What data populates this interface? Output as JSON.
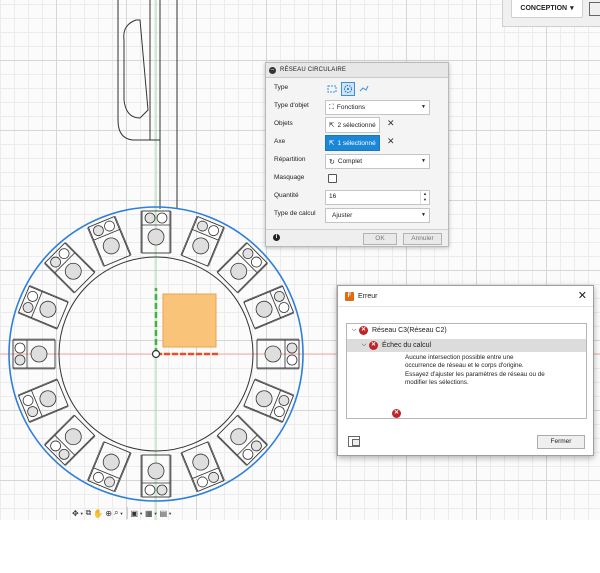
{
  "toolbar": {
    "workspace_label": "CONCEPTION",
    "workspace_caret": "▾"
  },
  "pattern_dialog": {
    "title": "RÉSEAU CIRCULAIRE",
    "rows": {
      "type": {
        "label": "Type"
      },
      "object_type": {
        "label": "Type d'objet",
        "value": "Fonctions",
        "icon": "feature-icon"
      },
      "objects": {
        "label": "Objets",
        "value": "2 sélectionné",
        "icon": "cursor-icon"
      },
      "axis": {
        "label": "Axe",
        "value": "1 sélectionné",
        "icon": "cursor-icon"
      },
      "distribution": {
        "label": "Répartition",
        "value": "Complet",
        "icon": "rotate-icon"
      },
      "suppression": {
        "label": "Masquage",
        "checked": false
      },
      "quantity": {
        "label": "Quantité",
        "value": "16"
      },
      "compute_type": {
        "label": "Type de calcul",
        "value": "Ajuster"
      }
    },
    "ok_label": "OK",
    "cancel_label": "Annuler"
  },
  "error_window": {
    "title": "Erreur",
    "tree": {
      "root": "Réseau C3(Réseau C2)",
      "child": "Échec du calcul",
      "message": [
        "Aucune intersection possible entre une",
        "occurrence de réseau et le corps d'origine.",
        "Essayez d'ajuster les paramètres de réseau ou de",
        "modifier les sélections."
      ]
    },
    "close_button": "Fermer"
  },
  "navbar": {
    "items": [
      "orbit-icon",
      "pan-icon",
      "hand-icon",
      "zoom-icon",
      "fit-icon",
      "display-icon",
      "grid-icon",
      "viewports-icon"
    ]
  },
  "colors": {
    "accent_blue": "#1c87d6",
    "selection_ring": "#2e7fd9",
    "axis_red": "#e8502a",
    "axis_green": "#3fb53f",
    "face_orange": "#f9c37a",
    "error_red": "#c0232a"
  }
}
